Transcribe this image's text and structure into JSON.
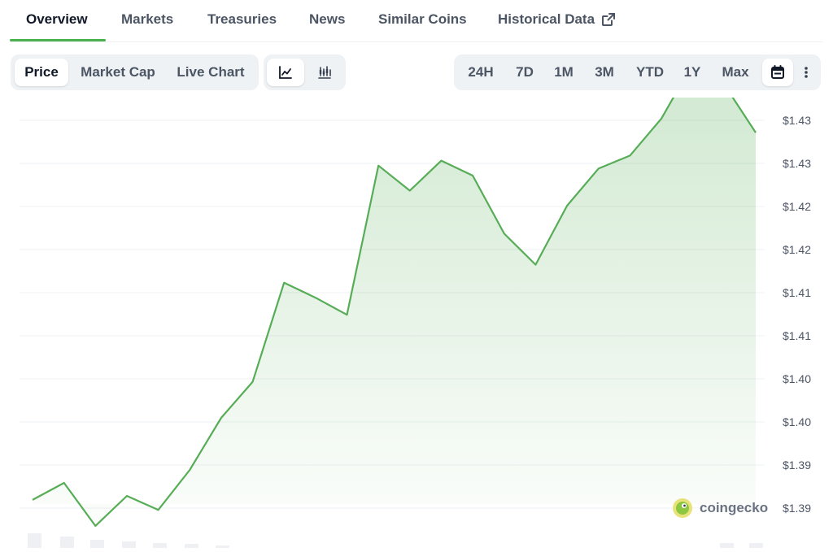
{
  "tabs": [
    {
      "label": "Overview"
    },
    {
      "label": "Markets"
    },
    {
      "label": "Treasuries"
    },
    {
      "label": "News"
    },
    {
      "label": "Similar Coins"
    },
    {
      "label": "Historical Data"
    }
  ],
  "active_tab": "Overview",
  "chart_tabs": {
    "price": "Price",
    "market_cap": "Market Cap",
    "live_chart": "Live Chart"
  },
  "chart_style_icons": [
    "line-chart-icon",
    "candlestick-chart-icon"
  ],
  "ranges": [
    "24H",
    "7D",
    "1M",
    "3M",
    "YTD",
    "1Y",
    "Max"
  ],
  "extra_icons": [
    "calendar-icon",
    "more-vertical-icon"
  ],
  "colors": {
    "accent": "#4bb14f",
    "line": "#57ad57"
  },
  "watermark": "coingecko",
  "chart_data": {
    "type": "area",
    "y_tick_labels": [
      "$1.43",
      "$1.43",
      "$1.42",
      "$1.42",
      "$1.41",
      "$1.41",
      "$1.40",
      "$1.40",
      "$1.39",
      "$1.39"
    ],
    "ylim": [
      1.3875,
      1.4325
    ],
    "grid": true,
    "series": [
      {
        "values": [
          1.3923,
          1.394,
          1.3897,
          1.3927,
          1.3913,
          1.3953,
          1.4005,
          1.4041,
          1.414,
          1.4125,
          1.4108,
          1.4257,
          1.4232,
          1.4262,
          1.4247,
          1.4189,
          1.4158,
          1.4217,
          1.4254,
          1.4267,
          1.4304,
          1.4359,
          1.4338,
          1.429
        ]
      }
    ]
  }
}
